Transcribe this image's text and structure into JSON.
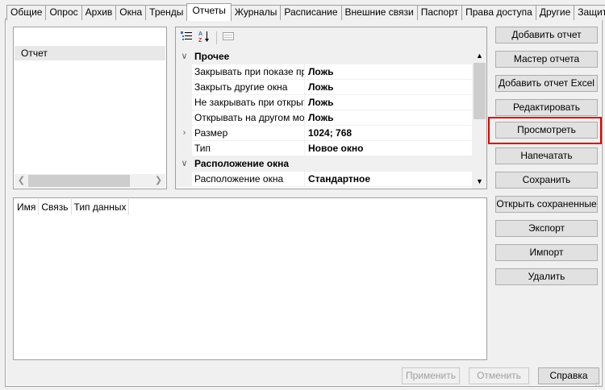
{
  "tabs": [
    "Общие",
    "Опрос",
    "Архив",
    "Окна",
    "Тренды",
    "Отчеты",
    "Журналы",
    "Расписание",
    "Внешние связи",
    "Паспорт",
    "Права доступа",
    "Другие",
    "Защита"
  ],
  "active_tab": "Отчеты",
  "report_list": {
    "items": [
      "Отчет"
    ]
  },
  "property_grid": {
    "toolbar": {
      "categorized_icon": "categorized-icon",
      "alphabetical_icon": "sort-az-icon",
      "pages_icon": "property-pages-icon"
    },
    "categories": [
      {
        "name": "Прочее",
        "rows": [
          {
            "name": "Закрывать при показе предыдущего",
            "value": "Ложь"
          },
          {
            "name": "Закрыть другие окна",
            "value": "Ложь"
          },
          {
            "name": "Не закрывать при открытии",
            "value": "Ложь"
          },
          {
            "name": "Открывать на другом мониторе",
            "value": "Ложь"
          },
          {
            "name": "Размер",
            "value": "1024; 768",
            "expandable": true
          },
          {
            "name": "Тип",
            "value": "Новое окно"
          }
        ]
      },
      {
        "name": "Расположение окна",
        "rows": [
          {
            "name": "Расположение окна",
            "value": "Стандартное"
          }
        ]
      }
    ]
  },
  "fields_table": {
    "columns": [
      "Имя",
      "Связь",
      "Тип данных"
    ]
  },
  "buttons": {
    "add_report": "Добавить отчет",
    "report_wizard": "Мастер отчета",
    "add_excel": "Добавить отчет Excel",
    "edit": "Редактировать",
    "view": "Просмотреть",
    "print": "Напечатать",
    "save": "Сохранить",
    "open_saved": "Открыть сохраненные",
    "export": "Экспорт",
    "import": "Импорт",
    "delete": "Удалить"
  },
  "footer": {
    "apply": "Применить",
    "cancel": "Отменить",
    "help": "Справка"
  },
  "highlight_color": "#e00000"
}
